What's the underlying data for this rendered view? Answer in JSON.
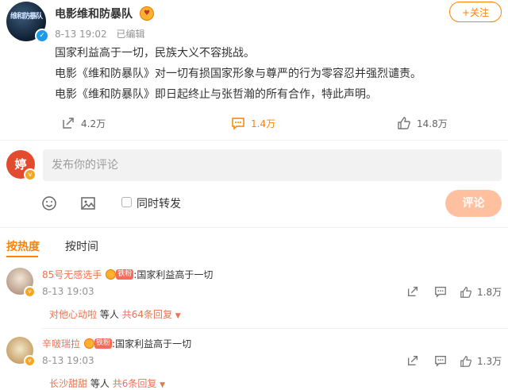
{
  "post": {
    "author": "电影维和防暴队",
    "avatar_text": "维和防暴队",
    "time": "8-13 19:02",
    "edited": "已编辑",
    "follow_label": "+关注",
    "lines": [
      "国家利益高于一切，民族大义不容挑战。",
      "电影《维和防暴队》对一切有损国家形象与尊严的行为零容忍并强烈谴责。",
      "电影《维和防暴队》即日起终止与张哲瀚的所有合作，特此声明。"
    ],
    "reposts": "4.2万",
    "comments": "1.4万",
    "likes": "14.8万"
  },
  "composer": {
    "placeholder": "发布你的评论",
    "repost_label": "同时转发",
    "submit_label": "评论"
  },
  "sort": {
    "hot": "按热度",
    "time": "按时间"
  },
  "comments": [
    {
      "name": "85号无感选手",
      "fan_label": "铁粉",
      "text": ":国家利益高于一切",
      "time": "8-13 19:03",
      "likes": "1.8万",
      "reply_user": "对他心动啦",
      "reply_mid": "等人",
      "reply_count": "共64条回复"
    },
    {
      "name": "辛啵瑞拉",
      "fan_label": "铁粉",
      "text": ":国家利益高于一切",
      "time": "8-13 19:03",
      "likes": "1.3万",
      "reply_user": "长沙甜甜",
      "reply_mid": "等人",
      "reply_count": "共6条回复"
    }
  ],
  "colors": {
    "accent": "#ff8200",
    "link": "#eb7350",
    "verified": "#1e9be8",
    "submit_disabled": "#ffc09f"
  }
}
